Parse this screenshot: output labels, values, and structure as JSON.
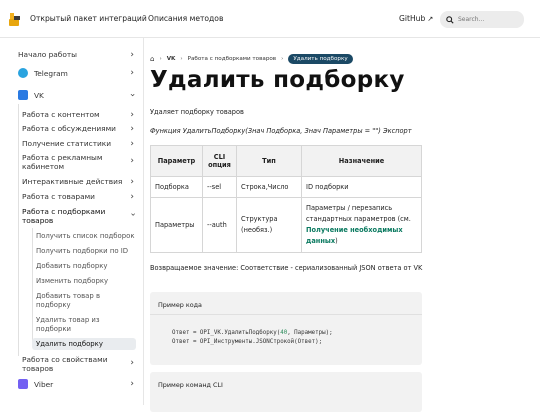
{
  "topbar": {
    "brand": "Открытый пакет интеграций",
    "nav_link": "Описания методов",
    "github": "GitHub",
    "search_placeholder": "Search..."
  },
  "sidebar": {
    "items": [
      {
        "label": "Начало работы"
      },
      {
        "label": "Telegram",
        "icon_color": "#2aa3df"
      },
      {
        "label": "VK",
        "icon_color": "#2a7ae2"
      },
      {
        "label": "Работа с контентом"
      },
      {
        "label": "Работа с обсуждениями"
      },
      {
        "label": "Получение статистики"
      },
      {
        "label": "Работа с рекламным кабинетом"
      },
      {
        "label": "Интерактивные действия"
      },
      {
        "label": "Работа с товарами"
      },
      {
        "label": "Работа с подборками товаров"
      },
      {
        "label": "Получить список подборок"
      },
      {
        "label": "Получить подборки по ID"
      },
      {
        "label": "Добавить подборку"
      },
      {
        "label": "Изменить подборку"
      },
      {
        "label": "Добавить товар в подборку"
      },
      {
        "label": "Удалить товар из подборки"
      },
      {
        "label": "Удалить подборку"
      },
      {
        "label": "Работа со свойствами товаров"
      },
      {
        "label": "Viber",
        "icon_color": "#7360f2"
      }
    ]
  },
  "breadcrumbs": {
    "vk": "VK",
    "section": "Работа с подборками товаров",
    "current": "Удалить подборку"
  },
  "page": {
    "title": "Удалить подборку",
    "description": "Удаляет подборку товаров",
    "signature": "Функция УдалитьПодборку(Знач Подборка, Знач Параметры = \"\") Экспорт",
    "return_text": "Возвращаемое значение: Соответствие - сериализованный JSON ответа от VK"
  },
  "table": {
    "headers": [
      "Параметр",
      "CLI опция",
      "Тип",
      "Назначение"
    ],
    "rows": [
      {
        "param": "Подборка",
        "cli": "--sel",
        "type": "Строка,Число",
        "desc": "ID подборки"
      },
      {
        "param": "Параметры",
        "cli": "--auth",
        "type": "Структура (необяз.)",
        "desc_prefix": "Параметры / перезапись стандартных параметров (см.",
        "desc_link": "Получение необходимых данных",
        "desc_suffix": ")"
      }
    ]
  },
  "code": {
    "example_label": "Пример кода",
    "line1_a": "Ответ = OPI_VK.УдалитьПодборку(",
    "line1_num": "40",
    "line1_b": ", Параметры);",
    "line2": "Ответ = OPI_Инструменты.JSONСтрокой(Ответ);",
    "cli_label": "Пример команд CLI"
  },
  "colors": {
    "breadcrumb_pill": "#1b4965",
    "link": "#0b7a60"
  }
}
